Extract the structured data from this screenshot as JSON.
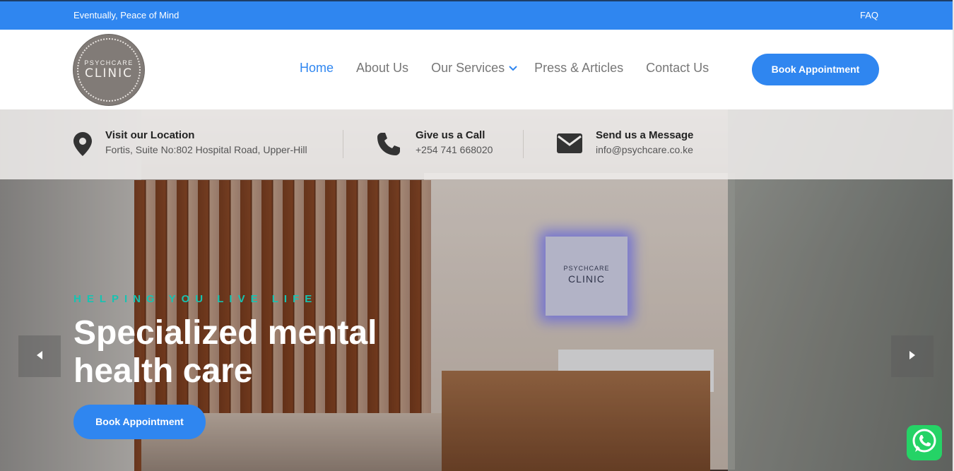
{
  "topbar": {
    "tagline": "Eventually, Peace of Mind",
    "faq": "FAQ"
  },
  "logo": {
    "top_text": "PSYCHCARE",
    "main_text": "CLINIC"
  },
  "nav": {
    "items": [
      {
        "label": "Home",
        "active": true
      },
      {
        "label": "About Us"
      },
      {
        "label": "Our Services",
        "has_dropdown": true
      },
      {
        "label": "Press & Articles"
      },
      {
        "label": "Contact Us"
      }
    ],
    "cta": "Book Appointment"
  },
  "info": {
    "location": {
      "title": "Visit our Location",
      "value": "Fortis, Suite No:802 Hospital Road, Upper-Hill",
      "icon": "map-pin-icon"
    },
    "call": {
      "title": "Give us a Call",
      "value": "+254 741 668020",
      "icon": "phone-icon"
    },
    "message": {
      "title": "Send us a Message",
      "value": "info@psychcare.co.ke",
      "icon": "envelope-icon"
    }
  },
  "hero": {
    "kicker": "HELPING YOU LIVE LIFE",
    "headline": "Specialized mental health care",
    "cta": "Book Appointment",
    "sign_top": "PSYCHCARE",
    "sign_main": "CLINIC"
  },
  "colors": {
    "accent": "#2f86f0",
    "kicker": "#17c3b2",
    "whatsapp": "#25d366"
  }
}
